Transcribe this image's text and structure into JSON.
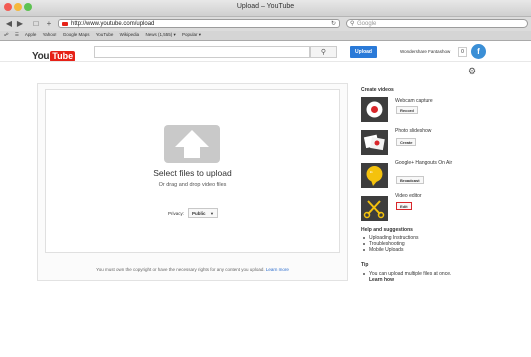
{
  "window": {
    "title": "Upload – YouTube"
  },
  "browser": {
    "url": "http://www.youtube.com/upload",
    "search_placeholder": "Google",
    "bookmarks": [
      "Apple",
      "Yahoo!",
      "Google Maps",
      "YouTube",
      "Wikipedia",
      "News (1,555) ▾",
      "Popular ▾"
    ]
  },
  "header": {
    "logo_you": "You",
    "logo_tube": "Tube",
    "upload_label": "Upload",
    "username": "Wondershare Fantashow",
    "notification_count": "0",
    "avatar_letter": "f"
  },
  "main": {
    "select_files": "Select files to upload",
    "drag_drop": "Or drag and drop video files",
    "privacy_label": "Privacy:",
    "privacy_value": "Public",
    "copyright_text": "You must own the copyright or have the necessary rights for any content you upload.",
    "learn_more": "Learn more"
  },
  "sidebar": {
    "create_heading": "Create videos",
    "items": [
      {
        "label": "Webcam capture",
        "button": "Record"
      },
      {
        "label": "Photo slideshow",
        "button": "Create"
      },
      {
        "label": "Google+ Hangouts On Air",
        "button": "Broadcast"
      },
      {
        "label": "Video editor",
        "button": "Edit"
      }
    ],
    "help_heading": "Help and suggestions",
    "help_links": [
      "Uploading Instructions",
      "Troubleshooting",
      "Mobile Uploads"
    ],
    "tip_heading": "Tip",
    "tip_text": "You can upload multiple files at once.",
    "tip_link": "Learn how"
  },
  "colors": {
    "accent": "#2a7ad8",
    "brand_red": "#e62117",
    "edit_highlight": "#d9262a"
  }
}
